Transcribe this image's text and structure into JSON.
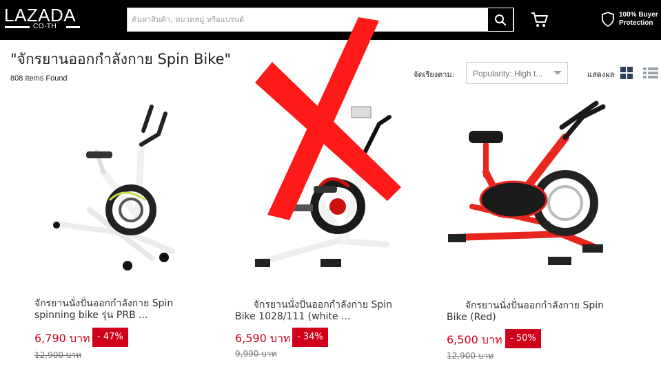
{
  "header": {
    "logo_main": "LAZADA",
    "logo_sub": "CO·TH",
    "search_placeholder": "ค้นหาสินค้า, หมวดหมู่ หรือแบรนด์",
    "search_icon": "search-icon",
    "cart_icon": "cart-icon",
    "protection_icon": "shield-icon",
    "protection_line1": "100% Buyer",
    "protection_line2": "Protection"
  },
  "page": {
    "title": "\"จักรยานออกกำลังกาย Spin Bike\"",
    "items_found": "808 Items Found"
  },
  "toolbar": {
    "sort_label": "จัดเรียงตาม:",
    "sort_value": "Popularity: High t...",
    "view_label": "แสดงผล",
    "grid_icon": "grid-view-icon",
    "list_icon": "list-view-icon"
  },
  "products": [
    {
      "name": "จักรยานนั่งปั่นออกกำลังกาย Spin\nspinning bike รุ่น PRB ...",
      "price": "6,790 บาท",
      "discount": "- 47%",
      "original_price": "12,900 บาท",
      "color": "#ffffff"
    },
    {
      "name": "      จักรยานนั่งปั่นออกกำลังกาย Spin\nBike 1028/111 (white ...",
      "price": "6,590 บาท",
      "discount": "- 34%",
      "original_price": "9,990 บาท",
      "color": "#ffffff"
    },
    {
      "name": "      จักรยานนั่งปั่นออกกำลังกาย Spin\nBike (Red)",
      "price": "6,500 บาท",
      "discount": "- 50%",
      "original_price": "12,900 บาท",
      "color": "#e8261e"
    }
  ],
  "overlay": {
    "icon": "red-x-mark",
    "color": "#ff1a1a"
  },
  "colors": {
    "header_bg": "#000000",
    "price": "#d0011b",
    "grid_icon": "#2d3f5a"
  }
}
